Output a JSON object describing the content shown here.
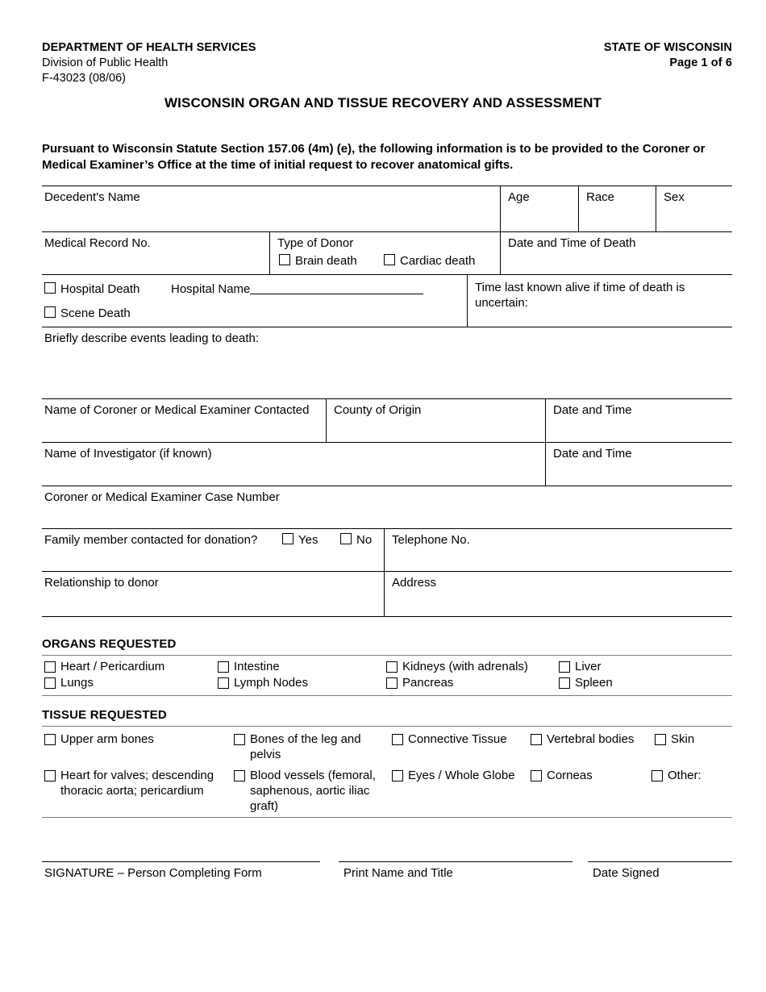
{
  "header": {
    "department": "DEPARTMENT OF HEALTH SERVICES",
    "division": "Division of Public Health",
    "form_number": "F-43023 (08/06)",
    "state": "STATE OF WISCONSIN",
    "page": "Page 1 of 6"
  },
  "title": "WISCONSIN ORGAN AND TISSUE RECOVERY AND ASSESSMENT",
  "statute": "Pursuant to Wisconsin Statute Section 157.06 (4m) (e), the following information is to be provided to the Coroner or Medical Examiner’s Office at the time of initial request to recover anatomical gifts.",
  "fields": {
    "decedent_name": "Decedent's Name",
    "age": "Age",
    "race": "Race",
    "sex": "Sex",
    "medical_record_no": "Medical Record No.",
    "type_of_donor": "Type of Donor",
    "brain_death": "Brain death",
    "cardiac_death": "Cardiac death",
    "date_time_of_death": "Date and Time of Death",
    "hospital_death": "Hospital Death",
    "hospital_name": "Hospital Name",
    "scene_death": "Scene Death",
    "time_last_known_alive": "Time last known alive if time of death is uncertain:",
    "briefly_describe": "Briefly describe events leading to death:",
    "coroner_name": "Name of Coroner or Medical Examiner Contacted",
    "county_of_origin": "County of Origin",
    "date_and_time_1": "Date and Time",
    "investigator_name": "Name of Investigator (if known)",
    "date_and_time_2": "Date and Time",
    "case_number": "Coroner or Medical Examiner Case Number",
    "family_contacted": "Family member contacted for donation?",
    "yes": "Yes",
    "no": "No",
    "telephone_no": "Telephone No.",
    "relationship_to_donor": "Relationship to donor",
    "address": "Address"
  },
  "organs": {
    "heading": "ORGANS REQUESTED",
    "items": [
      "Heart / Pericardium",
      "Intestine",
      "Kidneys (with adrenals)",
      "Liver",
      "Lungs",
      "Lymph Nodes",
      "Pancreas",
      "Spleen"
    ]
  },
  "tissue": {
    "heading": "TISSUE REQUESTED",
    "items": [
      "Upper arm bones",
      "Bones of the leg and pelvis",
      "Connective Tissue",
      "Vertebral bodies",
      "Skin",
      "Heart for valves; descending thoracic aorta; pericardium",
      "Blood vessels (femoral, saphenous, aortic iliac graft)",
      "Eyes / Whole Globe",
      "Corneas",
      "Other:"
    ]
  },
  "signature": {
    "signature_label": "SIGNATURE – Person Completing Form",
    "print_name_label": "Print Name and Title",
    "date_signed_label": "Date Signed"
  }
}
